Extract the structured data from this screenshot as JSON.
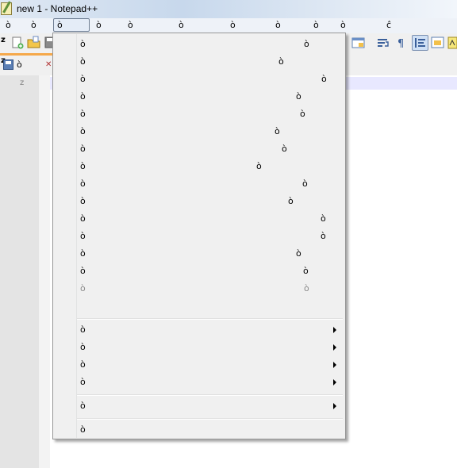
{
  "window": {
    "title": "new  1 - Notepad++"
  },
  "menubar": {
    "items": [
      {
        "label": "ò"
      },
      {
        "label": "ò"
      },
      {
        "label": "ò"
      },
      {
        "label": "ò"
      },
      {
        "label": "ò"
      },
      {
        "label": "ò"
      },
      {
        "label": "ò"
      },
      {
        "label": "ò"
      },
      {
        "label": "ò"
      },
      {
        "label": "ò"
      },
      {
        "label": "ĉ"
      }
    ]
  },
  "toolbar": {
    "row_label": "z"
  },
  "tabbar": {
    "prefix": "z",
    "tab_label": "ò"
  },
  "editor": {
    "line_number": "z"
  },
  "dropdown": {
    "group1": [
      {
        "label": "ò",
        "shortcut": "ò"
      },
      {
        "label": "ò",
        "shortcut": "ò"
      },
      {
        "label": "ò",
        "shortcut": "ò"
      },
      {
        "label": "ò",
        "shortcut": "ò"
      },
      {
        "label": "ò",
        "shortcut": "ò"
      },
      {
        "label": "ò",
        "shortcut": "ò"
      },
      {
        "label": "ò",
        "shortcut": "ò"
      },
      {
        "label": "ò",
        "shortcut": "ò"
      },
      {
        "label": "ò",
        "shortcut": "ò"
      },
      {
        "label": "ò",
        "shortcut": "ò"
      },
      {
        "label": "ò",
        "shortcut": "ò"
      },
      {
        "label": "ò",
        "shortcut": "ò"
      },
      {
        "label": "ò",
        "shortcut": "ò"
      },
      {
        "label": "ò",
        "shortcut": "ò",
        "disabled": true
      },
      {
        "label": "ò",
        "shortcut": "ò",
        "disabled": true
      }
    ],
    "group2": [
      {
        "label": "ò",
        "submenu": true
      },
      {
        "label": "ò",
        "submenu": true
      },
      {
        "label": "ò",
        "submenu": true
      },
      {
        "label": "ò",
        "submenu": true
      }
    ],
    "group3": [
      {
        "label": "ò",
        "submenu": true
      }
    ],
    "group4": [
      {
        "label": "ò"
      }
    ]
  }
}
